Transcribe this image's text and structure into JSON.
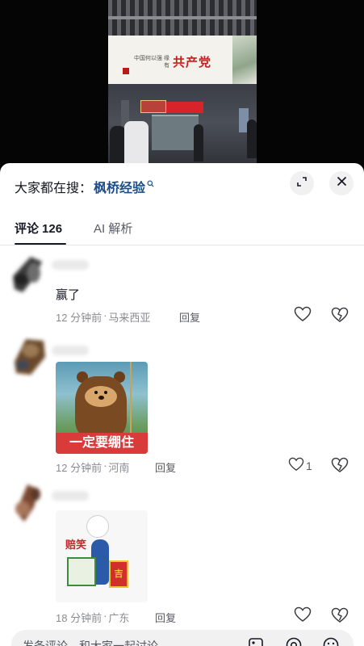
{
  "video": {
    "billboard_small_text": "中国何以强 缘有",
    "billboard_big_text": "共产党"
  },
  "panel": {
    "search_prefix": "大家都在搜：",
    "search_term": "枫桥经验",
    "tabs": [
      {
        "label": "评论",
        "count": "126"
      },
      {
        "label": "AI 解析"
      }
    ]
  },
  "comments": [
    {
      "text": "赢了",
      "time": "12 分钟前",
      "location": "马来西亚",
      "reply": "回复",
      "likes": ""
    },
    {
      "sticker_caption": "一定要绷住",
      "time": "12 分钟前",
      "location": "河南",
      "reply": "回复",
      "likes": "1"
    },
    {
      "sticker_caption": "赔笑",
      "sticker_bag_text": "吉",
      "time": "18 分钟前",
      "location": "广东",
      "reply": "回复",
      "likes": ""
    }
  ],
  "input_bar": {
    "placeholder": "发条评论，和大家一起讨论"
  },
  "colors": {
    "accent_link": "#1d4e89",
    "sticker_red": "#d93a3a"
  }
}
